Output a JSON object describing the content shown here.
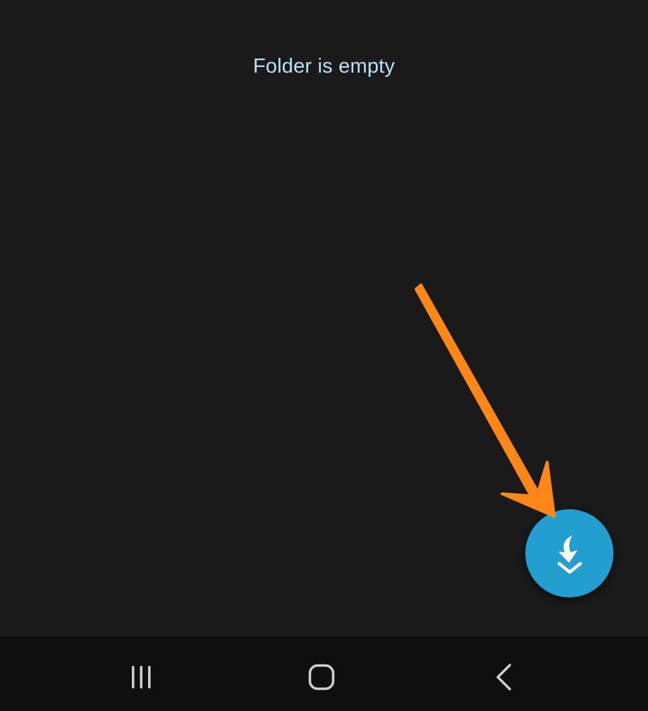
{
  "folder": {
    "empty_message": "Folder is empty"
  },
  "fab": {
    "icon": "download-arrow-icon",
    "color": "#239ed0"
  },
  "annotation": {
    "icon": "orange-arrow-pointer",
    "color": "#ff8717"
  },
  "navigation_bar": {
    "recents_icon": "recents-icon",
    "home_icon": "home-icon",
    "back_icon": "back-icon"
  }
}
